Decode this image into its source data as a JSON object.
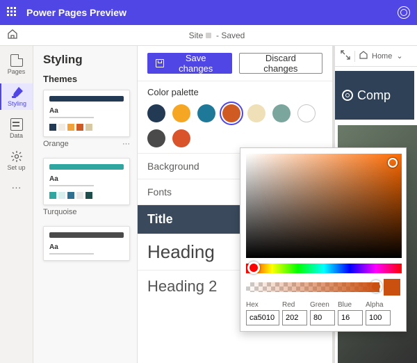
{
  "topbar": {
    "title": "Power Pages Preview"
  },
  "crumb": {
    "site_label": "Site",
    "state": "- Saved"
  },
  "rail": {
    "pages": "Pages",
    "styling": "Styling",
    "data": "Data",
    "setup": "Set up"
  },
  "panel": {
    "title": "Styling",
    "themes_title": "Themes",
    "theme1": {
      "name": "Orange",
      "header": "#223a53",
      "swatches": [
        "#223a53",
        "#f0ece4",
        "#f2a23a",
        "#cf5b22",
        "#d9c9a3"
      ]
    },
    "theme2": {
      "name": "Turquoise",
      "header": "#2fa7a0",
      "swatches": [
        "#2fa7a0",
        "#d7efed",
        "#2f6f8f",
        "#e8e8e8",
        "#1e4e4b"
      ]
    },
    "more": "···"
  },
  "center": {
    "save": "Save changes",
    "discard": "Discard changes",
    "color_palette": "Color palette",
    "colors": [
      "#223a53",
      "#f5a623",
      "#1e7898",
      "#cf5b22",
      "#efe0b8",
      "#7aa69d",
      "#ffffff",
      "#4a4a4a",
      "#d9532b"
    ],
    "selected_index": 3,
    "background": "Background",
    "fonts": "Fonts",
    "title_block": "Title",
    "h1": "Heading",
    "h2": "Heading 2"
  },
  "right": {
    "home": "Home",
    "chev": "⌄",
    "preview_brand": "Comp"
  },
  "picker": {
    "hex_label": "Hex",
    "red_label": "Red",
    "green_label": "Green",
    "blue_label": "Blue",
    "alpha_label": "Alpha",
    "hex": "ca5010",
    "red": "202",
    "green": "80",
    "blue": "16",
    "alpha": "100"
  }
}
